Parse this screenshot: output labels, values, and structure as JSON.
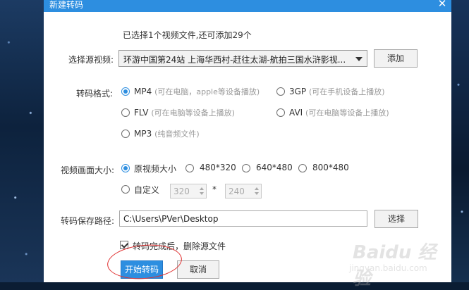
{
  "window": {
    "title": "新建转码",
    "close_glyph": "✕"
  },
  "summary": "已选择1个视频文件,还可添加29个",
  "source": {
    "label": "选择源视频:",
    "selected": "环游中国第24站 上海华西村-赶往太湖-航拍三国水浒影视...",
    "add_label": "添加"
  },
  "format": {
    "label": "转码格式:",
    "selected": "MP4",
    "options": [
      {
        "name": "MP4",
        "desc": "(可在电脑，apple等设备播放)"
      },
      {
        "name": "3GP",
        "desc": "(可在手机设备上播放)"
      },
      {
        "name": "FLV",
        "desc": "(可在电脑等设备上播放)"
      },
      {
        "name": "AVI",
        "desc": "(可在电脑等设备上播放)"
      },
      {
        "name": "MP3",
        "desc": "(纯音频文件)"
      }
    ]
  },
  "size": {
    "label": "视频画面大小:",
    "selected": "原视频大小",
    "options": [
      "原视频大小",
      "480*320",
      "640*480",
      "800*480"
    ],
    "custom_label": "自定义",
    "custom_width": "320",
    "custom_sep": "*",
    "custom_height": "240"
  },
  "save": {
    "label": "转码保存路径:",
    "path": "C:\\Users\\PVer\\Desktop",
    "choose_label": "选择"
  },
  "delete_after": {
    "label": "转码完成后，删除源文件",
    "checked": true
  },
  "actions": {
    "start_label": "开始转码",
    "cancel_label": "取消"
  },
  "watermark": {
    "main": "Baidu 经验",
    "sub": "jingyan.baidu.com"
  },
  "colors": {
    "accent": "#2d8ee0",
    "annotation": "#e03030"
  }
}
